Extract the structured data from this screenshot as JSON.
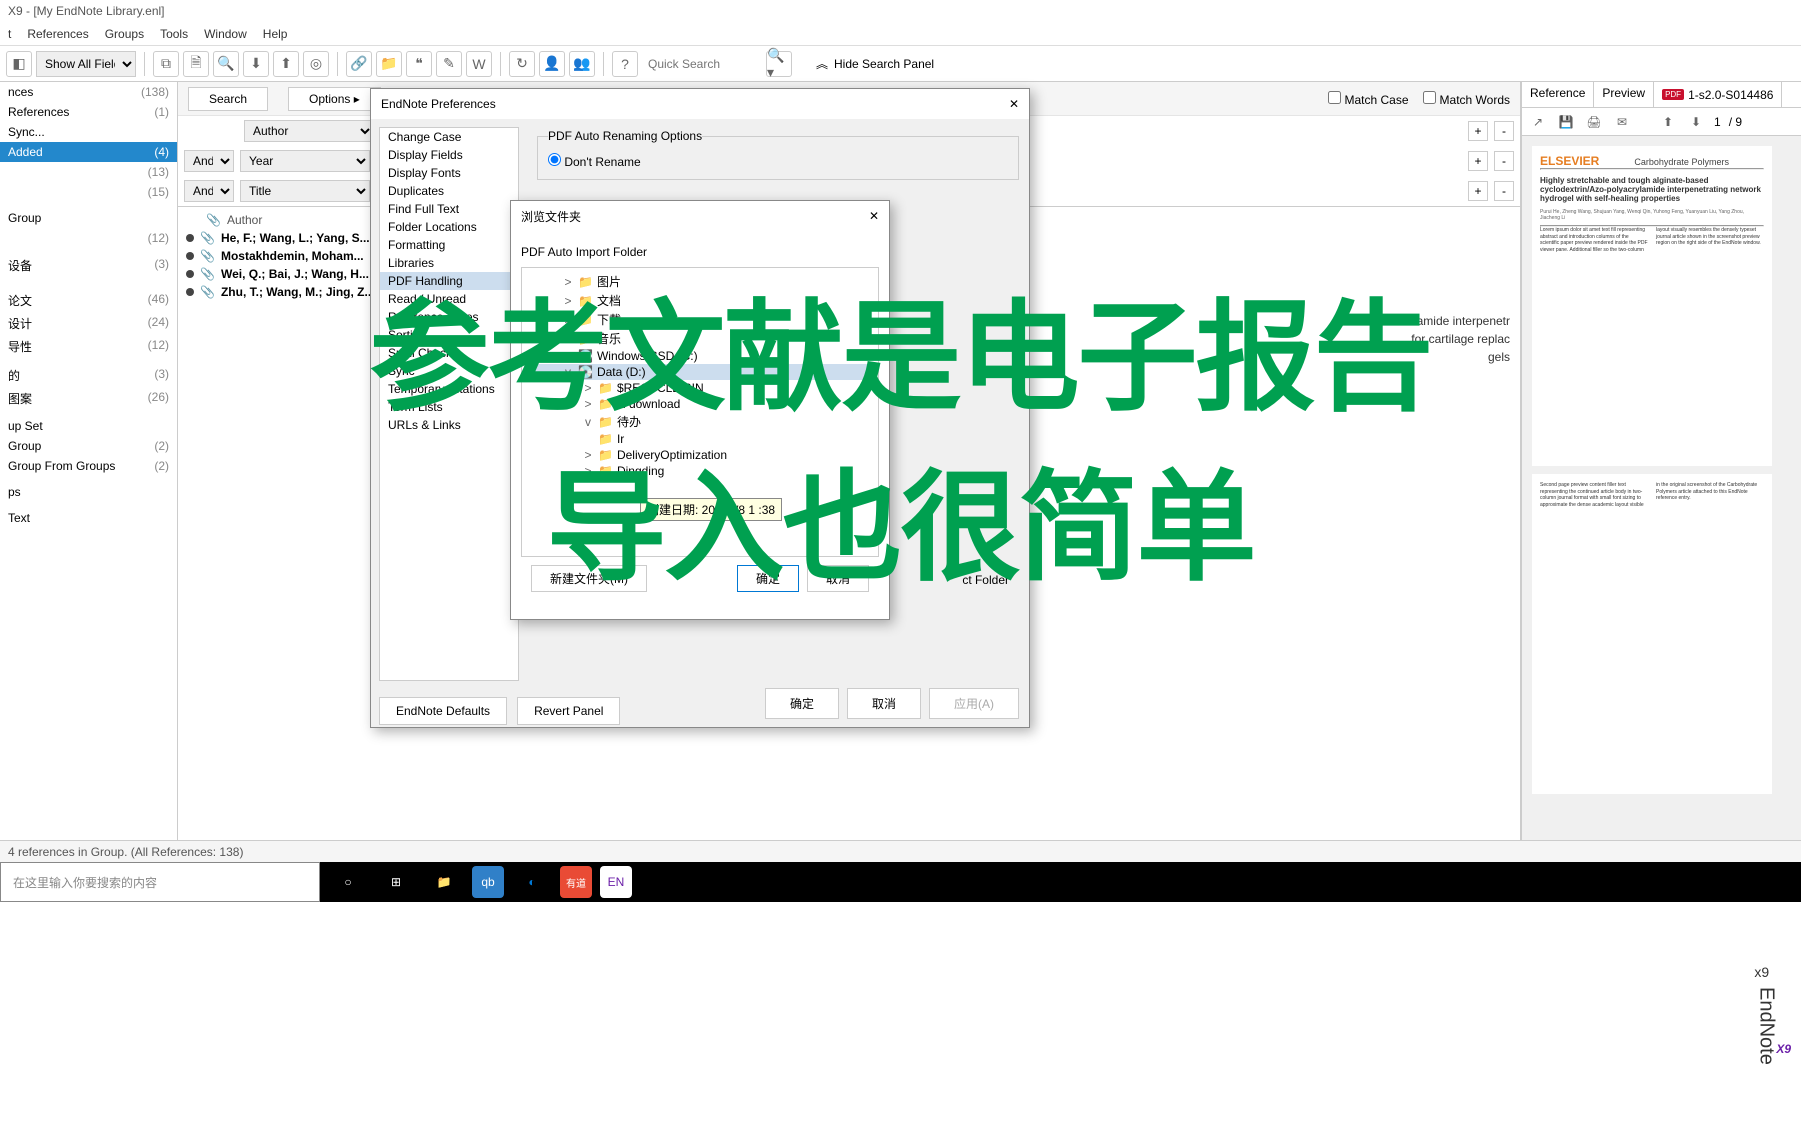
{
  "window": {
    "title": "X9 - [My EndNote Library.enl]"
  },
  "menu": {
    "items": [
      "t",
      "References",
      "Groups",
      "Tools",
      "Window",
      "Help"
    ]
  },
  "toolbar": {
    "show_fields": "Show All Fields",
    "quick_search": "Quick Search",
    "hide_search": "Hide Search Panel",
    "match_case": "Match Case",
    "match_words": "Match Words"
  },
  "left": {
    "items": [
      {
        "label": "nces",
        "count": "(138)"
      },
      {
        "label": "References",
        "count": "(1)"
      },
      {
        "label": "Sync...",
        "count": ""
      },
      {
        "label": "Added",
        "count": "(4)",
        "sel": true
      },
      {
        "label": "",
        "count": "(13)"
      },
      {
        "label": "",
        "count": "(15)"
      },
      {
        "label": "",
        "count": ""
      },
      {
        "label": "Group",
        "count": ""
      },
      {
        "label": "",
        "count": "(12)"
      },
      {
        "label": "",
        "count": ""
      },
      {
        "label": "设备",
        "count": "(3)"
      },
      {
        "label": "",
        "count": ""
      },
      {
        "label": "",
        "count": ""
      },
      {
        "label": "论文",
        "count": "(46)"
      },
      {
        "label": "设计",
        "count": "(24)"
      },
      {
        "label": "导性",
        "count": "(12)"
      },
      {
        "label": "",
        "count": ""
      },
      {
        "label": "的",
        "count": "(3)"
      },
      {
        "label": "图案",
        "count": "(26)"
      },
      {
        "label": "",
        "count": ""
      },
      {
        "label": "up Set",
        "count": ""
      },
      {
        "label": "Group",
        "count": "(2)"
      },
      {
        "label": "Group From Groups",
        "count": "(2)"
      },
      {
        "label": "",
        "count": ""
      },
      {
        "label": "ps",
        "count": ""
      },
      {
        "label": "",
        "count": ""
      },
      {
        "label": "Text",
        "count": ""
      }
    ]
  },
  "center": {
    "search_btn": "Search",
    "options_btn": "Options ▸",
    "rows": [
      {
        "op": "",
        "field": "Author"
      },
      {
        "op": "And",
        "field": "Year"
      },
      {
        "op": "And",
        "field": "Title"
      }
    ],
    "header_author": "Author",
    "refs": [
      {
        "author": "He, F.; Wang, L.; Yang, S..."
      },
      {
        "author": "Mostakhdemin, Moham..."
      },
      {
        "author": "Wei, Q.; Bai, J.; Wang, H..."
      },
      {
        "author": "Zhu, T.; Wang, M.; Jing, Z..."
      }
    ],
    "titles_visible": [
      "lamide interpenetr",
      "for cartilage replac",
      "gels"
    ]
  },
  "right": {
    "tabs": {
      "reference": "Reference",
      "preview": "Preview",
      "pdf_label": "1-s2.0-S014486",
      "pdf_badge": "PDF"
    },
    "page_info": {
      "current": "1",
      "total": "/ 9"
    },
    "journal_name": "Carbohydrate Polymers",
    "paper_title": "Highly stretchable and tough alginate-based cyclodextrin/Azo-polyacrylamide interpenetrating network hydrogel with self-healing properties"
  },
  "prefs": {
    "title": "EndNote Preferences",
    "list": [
      "Change Case",
      "Display Fields",
      "Display Fonts",
      "Duplicates",
      "Find Full Text",
      "Folder Locations",
      "Formatting",
      "Libraries",
      "PDF Handling",
      "Read / Unread",
      "Reference Types",
      "Sorting",
      "Spell Check",
      "Sync",
      "Temporary Citations",
      "Term Lists",
      "URLs & Links"
    ],
    "section": "PDF Auto Renaming Options",
    "dont_rename": "Don't Rename",
    "defaults_btn": "EndNote Defaults",
    "revert_btn": "Revert Panel",
    "ok": "确定",
    "cancel": "取消",
    "apply": "应用(A)",
    "ct_folder": "ct Folder"
  },
  "browse": {
    "title": "浏览文件夹",
    "subtitle": "PDF Auto Import Folder",
    "nodes": [
      {
        "label": "图片",
        "level": 2,
        "exp": ">",
        "icon": "📁"
      },
      {
        "label": "文档",
        "level": 2,
        "exp": ">",
        "icon": "📁"
      },
      {
        "label": "下载",
        "level": 2,
        "exp": ">",
        "icon": "📁"
      },
      {
        "label": "音乐",
        "level": 2,
        "exp": ">",
        "icon": "📁"
      },
      {
        "label": "Windows-SSD (C:)",
        "level": 2,
        "exp": ">",
        "icon": "💽"
      },
      {
        "label": "Data (D:)",
        "level": 2,
        "exp": "v",
        "icon": "💽",
        "sel": true
      },
      {
        "label": "$RECYCLE.BIN",
        "level": 3,
        "exp": ">",
        "icon": "📁"
      },
      {
        "label": "A-download",
        "level": 3,
        "exp": ">",
        "icon": "📁"
      },
      {
        "label": "待办",
        "level": 3,
        "exp": "v",
        "icon": "📁"
      },
      {
        "label": "Ir",
        "level": 3,
        "exp": "",
        "icon": "📁"
      },
      {
        "label": "DeliveryOptimization",
        "level": 3,
        "exp": ">",
        "icon": "📁"
      },
      {
        "label": "Dingding",
        "level": 3,
        "exp": ">",
        "icon": "📁"
      }
    ],
    "new_folder": "新建文件夹(M)",
    "ok": "确定",
    "cancel": "取消"
  },
  "tooltip": "创建日期: 20    /10/8 1   :38",
  "status": "4 references in Group. (All References: 138)",
  "taskbar": {
    "search_placeholder": "在这里输入你要搜索的内容"
  },
  "overlay": {
    "line1": "参考文献是电子报告",
    "line2": "导入也很简单"
  },
  "logo": "X9",
  "logo_brand": "EndNote",
  "logo_sup": "x9"
}
